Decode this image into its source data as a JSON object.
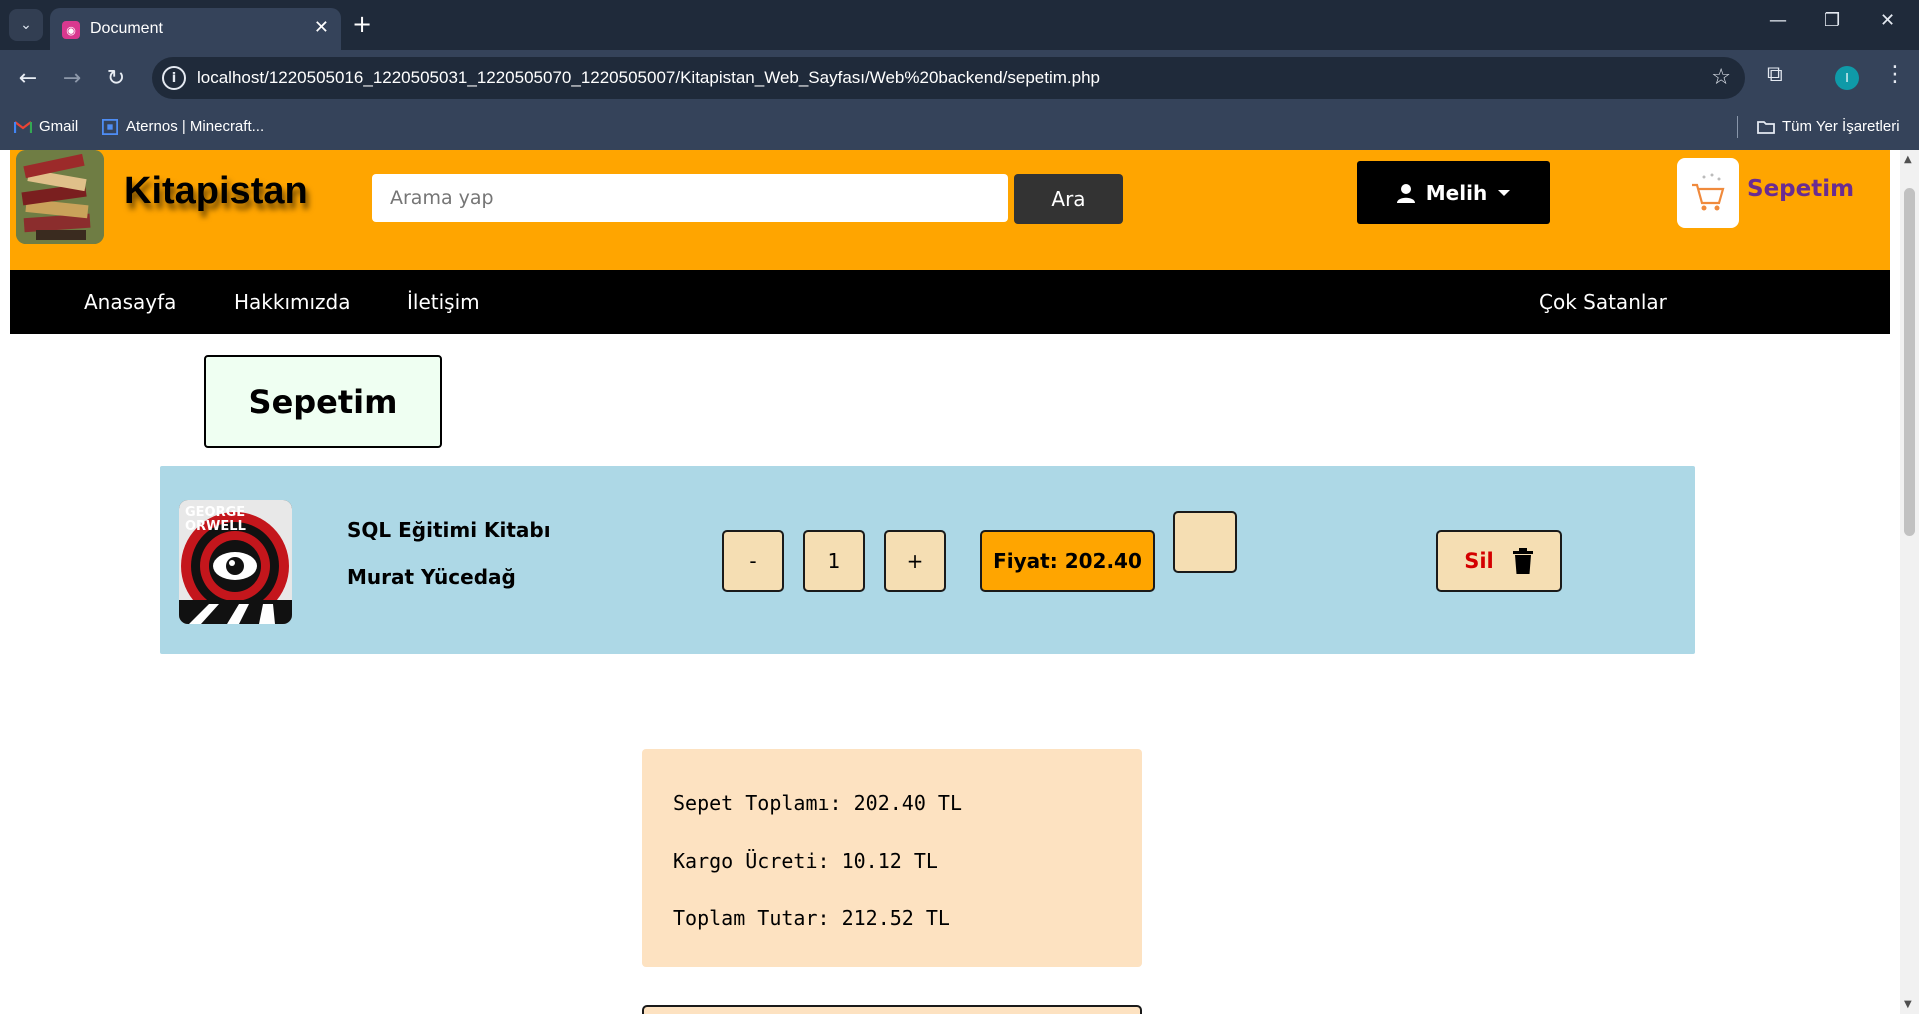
{
  "browser": {
    "tab_title": "Document",
    "url": "localhost/1220505016_1220505031_1220505070_1220505007/Kitapistan_Web_Sayfası/Web%20backend/sepetim.php",
    "profile_initial": "I",
    "bookmarks": [
      {
        "label": "Gmail",
        "icon": "gmail-icon"
      },
      {
        "label": "Aternos | Minecraft...",
        "icon": "aternos-icon"
      }
    ],
    "all_bookmarks_label": "Tüm Yer İşaretleri"
  },
  "header": {
    "site_name": "Kitapistan",
    "search_placeholder": "Arama yap",
    "search_button": "Ara",
    "user_name": "Melih",
    "cart_label": "Sepetim"
  },
  "nav": {
    "items": [
      "Anasayfa",
      "Hakkımızda",
      "İletişim"
    ],
    "right_item": "Çok Satanlar"
  },
  "cart": {
    "title": "Sepetim",
    "item": {
      "name": "SQL Eğitimi Kitabı",
      "author": "Murat Yücedağ",
      "cover_text_1": "GEORGE",
      "cover_text_2": "ORWELL",
      "quantity": "1",
      "minus_label": "-",
      "plus_label": "+",
      "price_label": "Fiyat: 202.40",
      "delete_label": "Sil"
    },
    "summary": {
      "subtotal": "Sepet Toplamı: 202.40 TL",
      "shipping": "Kargo Ücreti: 10.12 TL",
      "total": "Toplam Tutar: 212.52 TL"
    }
  },
  "colors": {
    "header_bg": "#ffa500",
    "nav_bg": "#000000",
    "item_bg": "#add8e6",
    "summary_bg": "#fde2c1",
    "cart_link": "#6a2c91",
    "delete_text": "#d40000"
  }
}
